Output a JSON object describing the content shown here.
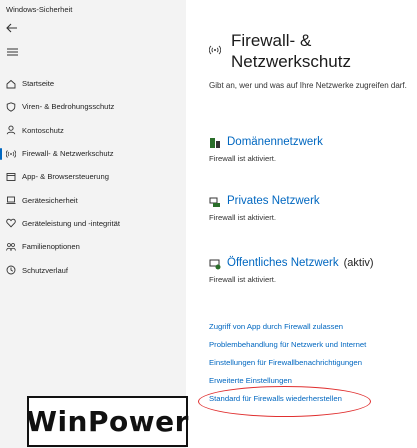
{
  "window": {
    "title": "Windows-Sicherheit"
  },
  "sidebar": {
    "back_icon": "back-arrow-icon",
    "menu_icon": "hamburger-menu-icon",
    "items": [
      {
        "label": "Startseite",
        "icon": "home-icon",
        "active": false
      },
      {
        "label": "Viren- & Bedrohungsschutz",
        "icon": "shield-icon",
        "active": false
      },
      {
        "label": "Kontoschutz",
        "icon": "person-icon",
        "active": false
      },
      {
        "label": "Firewall- & Netzwerkschutz",
        "icon": "wifi-antenna-icon",
        "active": true
      },
      {
        "label": "App- & Browsersteuerung",
        "icon": "app-browser-icon",
        "active": false
      },
      {
        "label": "Gerätesicherheit",
        "icon": "device-laptop-icon",
        "active": false
      },
      {
        "label": "Geräteleistung und -integrität",
        "icon": "heart-icon",
        "active": false
      },
      {
        "label": "Familienoptionen",
        "icon": "family-icon",
        "active": false
      },
      {
        "label": "Schutzverlauf",
        "icon": "history-clock-icon",
        "active": false
      }
    ]
  },
  "main": {
    "title": "Firewall- & Netzwerkschutz",
    "description": "Gibt an, wer und was auf Ihre Netzwerke zugreifen darf.",
    "networks": [
      {
        "name": "Domänennetzwerk",
        "icon": "domain-network-icon",
        "tag": "",
        "status": "Firewall ist aktiviert."
      },
      {
        "name": "Privates Netzwerk",
        "icon": "private-network-icon",
        "tag": "",
        "status": "Firewall ist aktiviert."
      },
      {
        "name": "Öffentliches Netzwerk",
        "icon": "public-network-icon",
        "tag": "(aktiv)",
        "status": "Firewall ist aktiviert."
      }
    ],
    "links": [
      "Zugriff von App durch Firewall zulassen",
      "Problembehandlung für Netzwerk und Internet",
      "Einstellungen für Firewallbenachrichtigungen",
      "Erweiterte Einstellungen",
      "Standard für Firewalls wiederherstellen"
    ]
  },
  "colors": {
    "accent": "#0067c0",
    "highlight_ellipse": "#e03030",
    "sidebar_bg": "#f3f3f3"
  },
  "watermark": {
    "text": "WinPower"
  }
}
